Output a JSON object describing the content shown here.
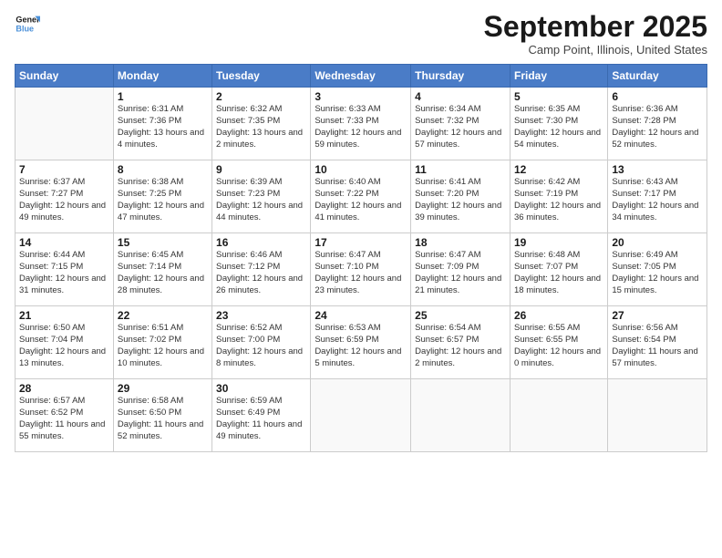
{
  "logo": {
    "line1": "General",
    "line2": "Blue"
  },
  "title": "September 2025",
  "location": "Camp Point, Illinois, United States",
  "days_header": [
    "Sunday",
    "Monday",
    "Tuesday",
    "Wednesday",
    "Thursday",
    "Friday",
    "Saturday"
  ],
  "weeks": [
    [
      {
        "num": "",
        "sunrise": "",
        "sunset": "",
        "daylight": ""
      },
      {
        "num": "1",
        "sunrise": "Sunrise: 6:31 AM",
        "sunset": "Sunset: 7:36 PM",
        "daylight": "Daylight: 13 hours and 4 minutes."
      },
      {
        "num": "2",
        "sunrise": "Sunrise: 6:32 AM",
        "sunset": "Sunset: 7:35 PM",
        "daylight": "Daylight: 13 hours and 2 minutes."
      },
      {
        "num": "3",
        "sunrise": "Sunrise: 6:33 AM",
        "sunset": "Sunset: 7:33 PM",
        "daylight": "Daylight: 12 hours and 59 minutes."
      },
      {
        "num": "4",
        "sunrise": "Sunrise: 6:34 AM",
        "sunset": "Sunset: 7:32 PM",
        "daylight": "Daylight: 12 hours and 57 minutes."
      },
      {
        "num": "5",
        "sunrise": "Sunrise: 6:35 AM",
        "sunset": "Sunset: 7:30 PM",
        "daylight": "Daylight: 12 hours and 54 minutes."
      },
      {
        "num": "6",
        "sunrise": "Sunrise: 6:36 AM",
        "sunset": "Sunset: 7:28 PM",
        "daylight": "Daylight: 12 hours and 52 minutes."
      }
    ],
    [
      {
        "num": "7",
        "sunrise": "Sunrise: 6:37 AM",
        "sunset": "Sunset: 7:27 PM",
        "daylight": "Daylight: 12 hours and 49 minutes."
      },
      {
        "num": "8",
        "sunrise": "Sunrise: 6:38 AM",
        "sunset": "Sunset: 7:25 PM",
        "daylight": "Daylight: 12 hours and 47 minutes."
      },
      {
        "num": "9",
        "sunrise": "Sunrise: 6:39 AM",
        "sunset": "Sunset: 7:23 PM",
        "daylight": "Daylight: 12 hours and 44 minutes."
      },
      {
        "num": "10",
        "sunrise": "Sunrise: 6:40 AM",
        "sunset": "Sunset: 7:22 PM",
        "daylight": "Daylight: 12 hours and 41 minutes."
      },
      {
        "num": "11",
        "sunrise": "Sunrise: 6:41 AM",
        "sunset": "Sunset: 7:20 PM",
        "daylight": "Daylight: 12 hours and 39 minutes."
      },
      {
        "num": "12",
        "sunrise": "Sunrise: 6:42 AM",
        "sunset": "Sunset: 7:19 PM",
        "daylight": "Daylight: 12 hours and 36 minutes."
      },
      {
        "num": "13",
        "sunrise": "Sunrise: 6:43 AM",
        "sunset": "Sunset: 7:17 PM",
        "daylight": "Daylight: 12 hours and 34 minutes."
      }
    ],
    [
      {
        "num": "14",
        "sunrise": "Sunrise: 6:44 AM",
        "sunset": "Sunset: 7:15 PM",
        "daylight": "Daylight: 12 hours and 31 minutes."
      },
      {
        "num": "15",
        "sunrise": "Sunrise: 6:45 AM",
        "sunset": "Sunset: 7:14 PM",
        "daylight": "Daylight: 12 hours and 28 minutes."
      },
      {
        "num": "16",
        "sunrise": "Sunrise: 6:46 AM",
        "sunset": "Sunset: 7:12 PM",
        "daylight": "Daylight: 12 hours and 26 minutes."
      },
      {
        "num": "17",
        "sunrise": "Sunrise: 6:47 AM",
        "sunset": "Sunset: 7:10 PM",
        "daylight": "Daylight: 12 hours and 23 minutes."
      },
      {
        "num": "18",
        "sunrise": "Sunrise: 6:47 AM",
        "sunset": "Sunset: 7:09 PM",
        "daylight": "Daylight: 12 hours and 21 minutes."
      },
      {
        "num": "19",
        "sunrise": "Sunrise: 6:48 AM",
        "sunset": "Sunset: 7:07 PM",
        "daylight": "Daylight: 12 hours and 18 minutes."
      },
      {
        "num": "20",
        "sunrise": "Sunrise: 6:49 AM",
        "sunset": "Sunset: 7:05 PM",
        "daylight": "Daylight: 12 hours and 15 minutes."
      }
    ],
    [
      {
        "num": "21",
        "sunrise": "Sunrise: 6:50 AM",
        "sunset": "Sunset: 7:04 PM",
        "daylight": "Daylight: 12 hours and 13 minutes."
      },
      {
        "num": "22",
        "sunrise": "Sunrise: 6:51 AM",
        "sunset": "Sunset: 7:02 PM",
        "daylight": "Daylight: 12 hours and 10 minutes."
      },
      {
        "num": "23",
        "sunrise": "Sunrise: 6:52 AM",
        "sunset": "Sunset: 7:00 PM",
        "daylight": "Daylight: 12 hours and 8 minutes."
      },
      {
        "num": "24",
        "sunrise": "Sunrise: 6:53 AM",
        "sunset": "Sunset: 6:59 PM",
        "daylight": "Daylight: 12 hours and 5 minutes."
      },
      {
        "num": "25",
        "sunrise": "Sunrise: 6:54 AM",
        "sunset": "Sunset: 6:57 PM",
        "daylight": "Daylight: 12 hours and 2 minutes."
      },
      {
        "num": "26",
        "sunrise": "Sunrise: 6:55 AM",
        "sunset": "Sunset: 6:55 PM",
        "daylight": "Daylight: 12 hours and 0 minutes."
      },
      {
        "num": "27",
        "sunrise": "Sunrise: 6:56 AM",
        "sunset": "Sunset: 6:54 PM",
        "daylight": "Daylight: 11 hours and 57 minutes."
      }
    ],
    [
      {
        "num": "28",
        "sunrise": "Sunrise: 6:57 AM",
        "sunset": "Sunset: 6:52 PM",
        "daylight": "Daylight: 11 hours and 55 minutes."
      },
      {
        "num": "29",
        "sunrise": "Sunrise: 6:58 AM",
        "sunset": "Sunset: 6:50 PM",
        "daylight": "Daylight: 11 hours and 52 minutes."
      },
      {
        "num": "30",
        "sunrise": "Sunrise: 6:59 AM",
        "sunset": "Sunset: 6:49 PM",
        "daylight": "Daylight: 11 hours and 49 minutes."
      },
      {
        "num": "",
        "sunrise": "",
        "sunset": "",
        "daylight": ""
      },
      {
        "num": "",
        "sunrise": "",
        "sunset": "",
        "daylight": ""
      },
      {
        "num": "",
        "sunrise": "",
        "sunset": "",
        "daylight": ""
      },
      {
        "num": "",
        "sunrise": "",
        "sunset": "",
        "daylight": ""
      }
    ]
  ]
}
